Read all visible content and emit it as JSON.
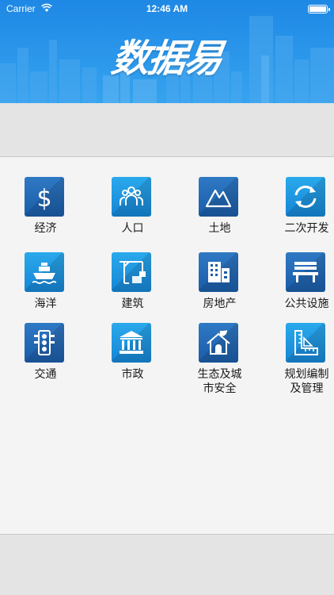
{
  "status_bar": {
    "carrier": "Carrier",
    "time": "12:46 AM"
  },
  "app_title": "数据易",
  "grid": [
    {
      "label": "经济",
      "icon": "dollar-icon",
      "style": "dark"
    },
    {
      "label": "人口",
      "icon": "people-icon",
      "style": "light"
    },
    {
      "label": "土地",
      "icon": "mountain-icon",
      "style": "dark"
    },
    {
      "label": "二次开发",
      "icon": "refresh-icon",
      "style": "light"
    },
    {
      "label": "海洋",
      "icon": "ship-icon",
      "style": "light"
    },
    {
      "label": "建筑",
      "icon": "crane-icon",
      "style": "light"
    },
    {
      "label": "房地产",
      "icon": "building-icon",
      "style": "dark"
    },
    {
      "label": "公共设施",
      "icon": "bench-icon",
      "style": "dark"
    },
    {
      "label": "交通",
      "icon": "traffic-light-icon",
      "style": "dark"
    },
    {
      "label": "市政",
      "icon": "government-icon",
      "style": "light"
    },
    {
      "label": "生态及城\n市安全",
      "icon": "eco-house-icon",
      "style": "dark"
    },
    {
      "label": "规划编制\n及管理",
      "icon": "ruler-icon",
      "style": "light"
    }
  ]
}
